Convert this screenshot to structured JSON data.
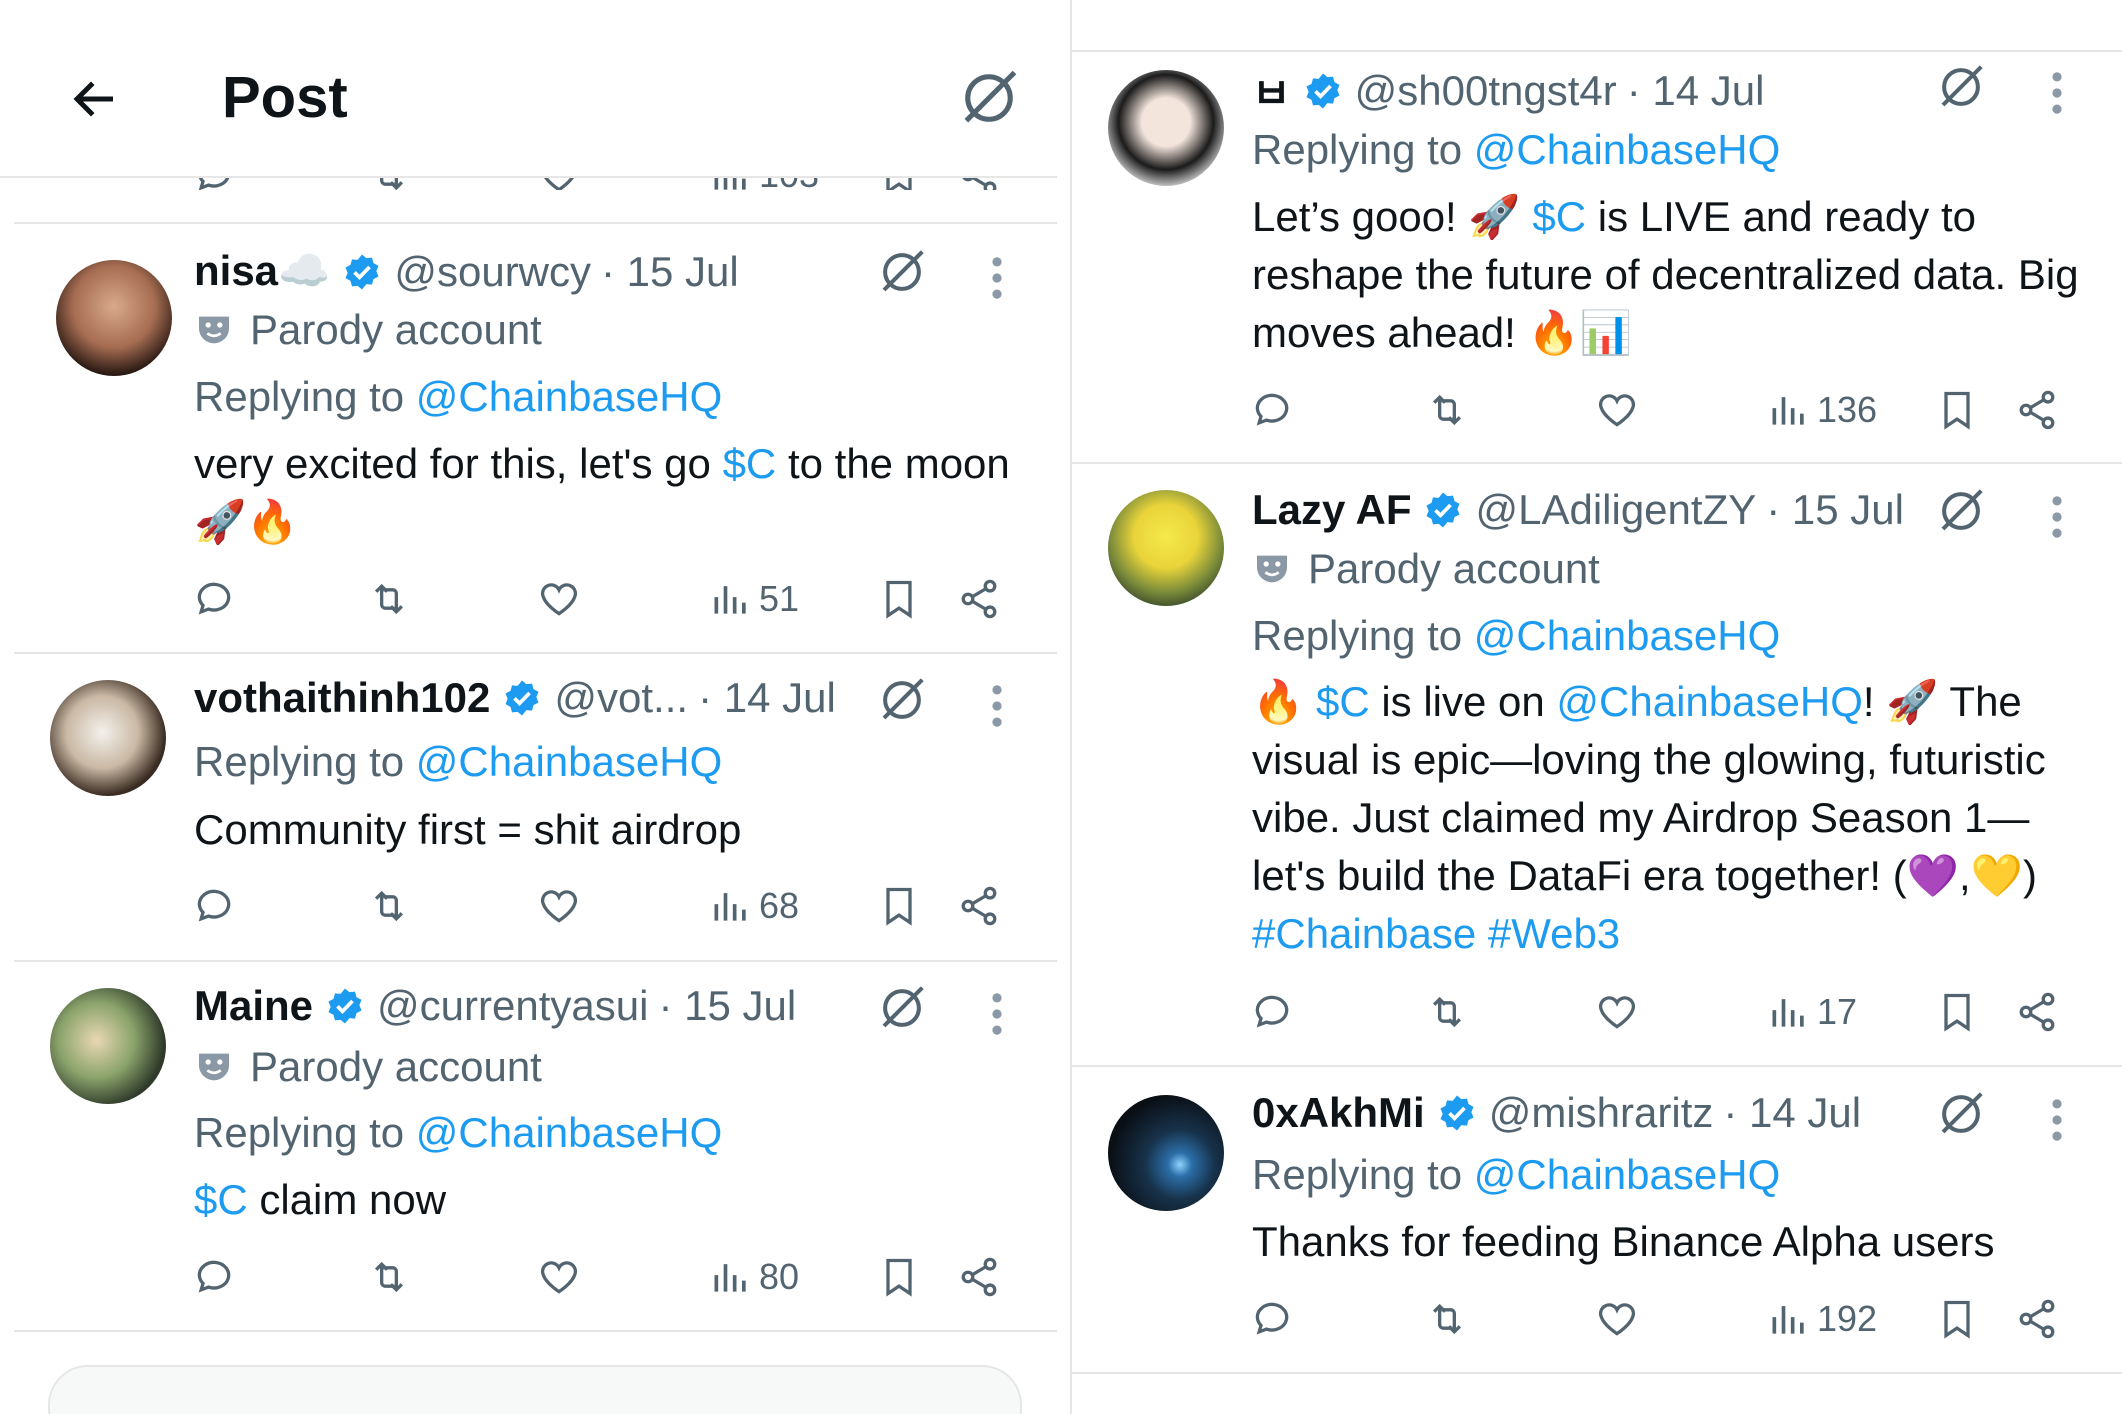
{
  "header": {
    "title": "Post"
  },
  "left_posts": [
    {
      "name": "nisa☁️",
      "handle": "@sourwcy",
      "date": "· 15 Jul",
      "parody": "Parody account",
      "replying_prefix": "Replying to ",
      "replying_to": "@ChainbaseHQ",
      "text": [
        [
          "very excited for this, let's go ",
          ""
        ],
        [
          "$C",
          "link"
        ],
        [
          " to the moon 🚀🔥",
          ""
        ]
      ],
      "views": "51"
    },
    {
      "name": "vothaithinh102",
      "handle": "@vot...",
      "date": "· 14 Jul",
      "replying_prefix": "Replying to ",
      "replying_to": "@ChainbaseHQ",
      "text": [
        [
          "Community first = shit airdrop",
          ""
        ]
      ],
      "views": "68"
    },
    {
      "name": "Maine",
      "handle": "@currentyasui",
      "date": "· 15 Jul",
      "parody": "Parody account",
      "replying_prefix": "Replying to ",
      "replying_to": "@ChainbaseHQ",
      "text": [
        [
          "$C",
          "link"
        ],
        [
          " claim now",
          ""
        ]
      ],
      "views": "80"
    }
  ],
  "right_posts": [
    {
      "name": "ㅂ",
      "handle": "@sh00tngst4r",
      "date": "· 14 Jul",
      "replying_prefix": "Replying to ",
      "replying_to": "@ChainbaseHQ",
      "text": [
        [
          "Let’s gooo! 🚀 ",
          ""
        ],
        [
          "$C",
          "link"
        ],
        [
          " is LIVE and ready to reshape the future of decentralized data. Big moves ahead! 🔥📊",
          ""
        ]
      ],
      "views": "136"
    },
    {
      "name": "Lazy AF",
      "handle": "@LAdiligentZY",
      "date": "· 15 Jul",
      "parody": "Parody account",
      "replying_prefix": "Replying to ",
      "replying_to": "@ChainbaseHQ",
      "text": [
        [
          "🔥 ",
          ""
        ],
        [
          "$C",
          "link"
        ],
        [
          " is live on ",
          ""
        ],
        [
          "@ChainbaseHQ",
          "link"
        ],
        [
          "! 🚀 The visual is epic—loving the glowing, futuristic vibe. Just claimed my Airdrop Season 1—let's build the DataFi era together! (💜,💛) ",
          ""
        ],
        [
          "#Chainbase",
          "link"
        ],
        [
          " ",
          ""
        ],
        [
          "#Web3",
          "link"
        ]
      ],
      "views": "17"
    },
    {
      "name": "0xAkhMi",
      "handle": "@mishraritz",
      "date": "· 14 Jul",
      "replying_prefix": "Replying to ",
      "replying_to": "@ChainbaseHQ",
      "text": [
        [
          "Thanks for feeding Binance Alpha users",
          ""
        ]
      ],
      "views": "192"
    }
  ],
  "peek": {
    "views": "103"
  },
  "colors": {
    "link": "#1d9bf0",
    "verified": "#1d9bf0",
    "secondary": "#536471",
    "divider": "#e6e6e6"
  },
  "icons": [
    "back-arrow-icon",
    "grok-icon",
    "verified-badge-icon",
    "parody-mask-icon",
    "reply-icon",
    "repost-icon",
    "like-icon",
    "views-icon",
    "bookmark-icon",
    "share-icon",
    "more-icon"
  ]
}
